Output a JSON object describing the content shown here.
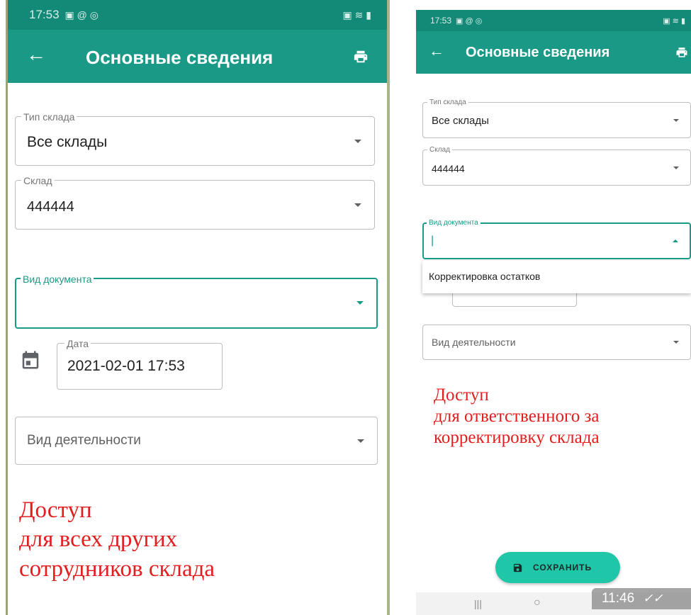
{
  "left": {
    "status_time": "17:53",
    "appbar_title": "Основные сведения",
    "warehouse_type": {
      "label": "Тип склада",
      "value": "Все склады"
    },
    "warehouse": {
      "label": "Склад",
      "value": "444444"
    },
    "doc_type": {
      "label": "Вид документа",
      "value": ""
    },
    "date": {
      "label": "Дата",
      "value": "2021-02-01 17:53"
    },
    "activity": {
      "placeholder": "Вид деятельности"
    },
    "note": "Доступ\nдля всех других\nсотрудников склада"
  },
  "right": {
    "status_time": "17:53",
    "appbar_title": "Основные сведения",
    "warehouse_type": {
      "label": "Тип склада",
      "value": "Все склады"
    },
    "warehouse": {
      "label": "Склад",
      "value": "444444"
    },
    "doc_type": {
      "label": "Вид документа",
      "value": "|"
    },
    "dropdown_option": "Корректировка остатков",
    "activity": {
      "placeholder": "Вид деятельности"
    },
    "note": "Доступ\nдля ответственного за\nкорректировку склада",
    "save_button": "СОХРАНИТЬ",
    "clock_badge": "11:46"
  },
  "colors": {
    "accent": "#1a9a86",
    "statusbar": "#138a78",
    "note": "#e31e1e"
  },
  "icons": [
    "back-arrow-icon",
    "print-icon",
    "calendar-icon",
    "dropdown-caret-icon",
    "save-icon",
    "double-check-icon"
  ]
}
